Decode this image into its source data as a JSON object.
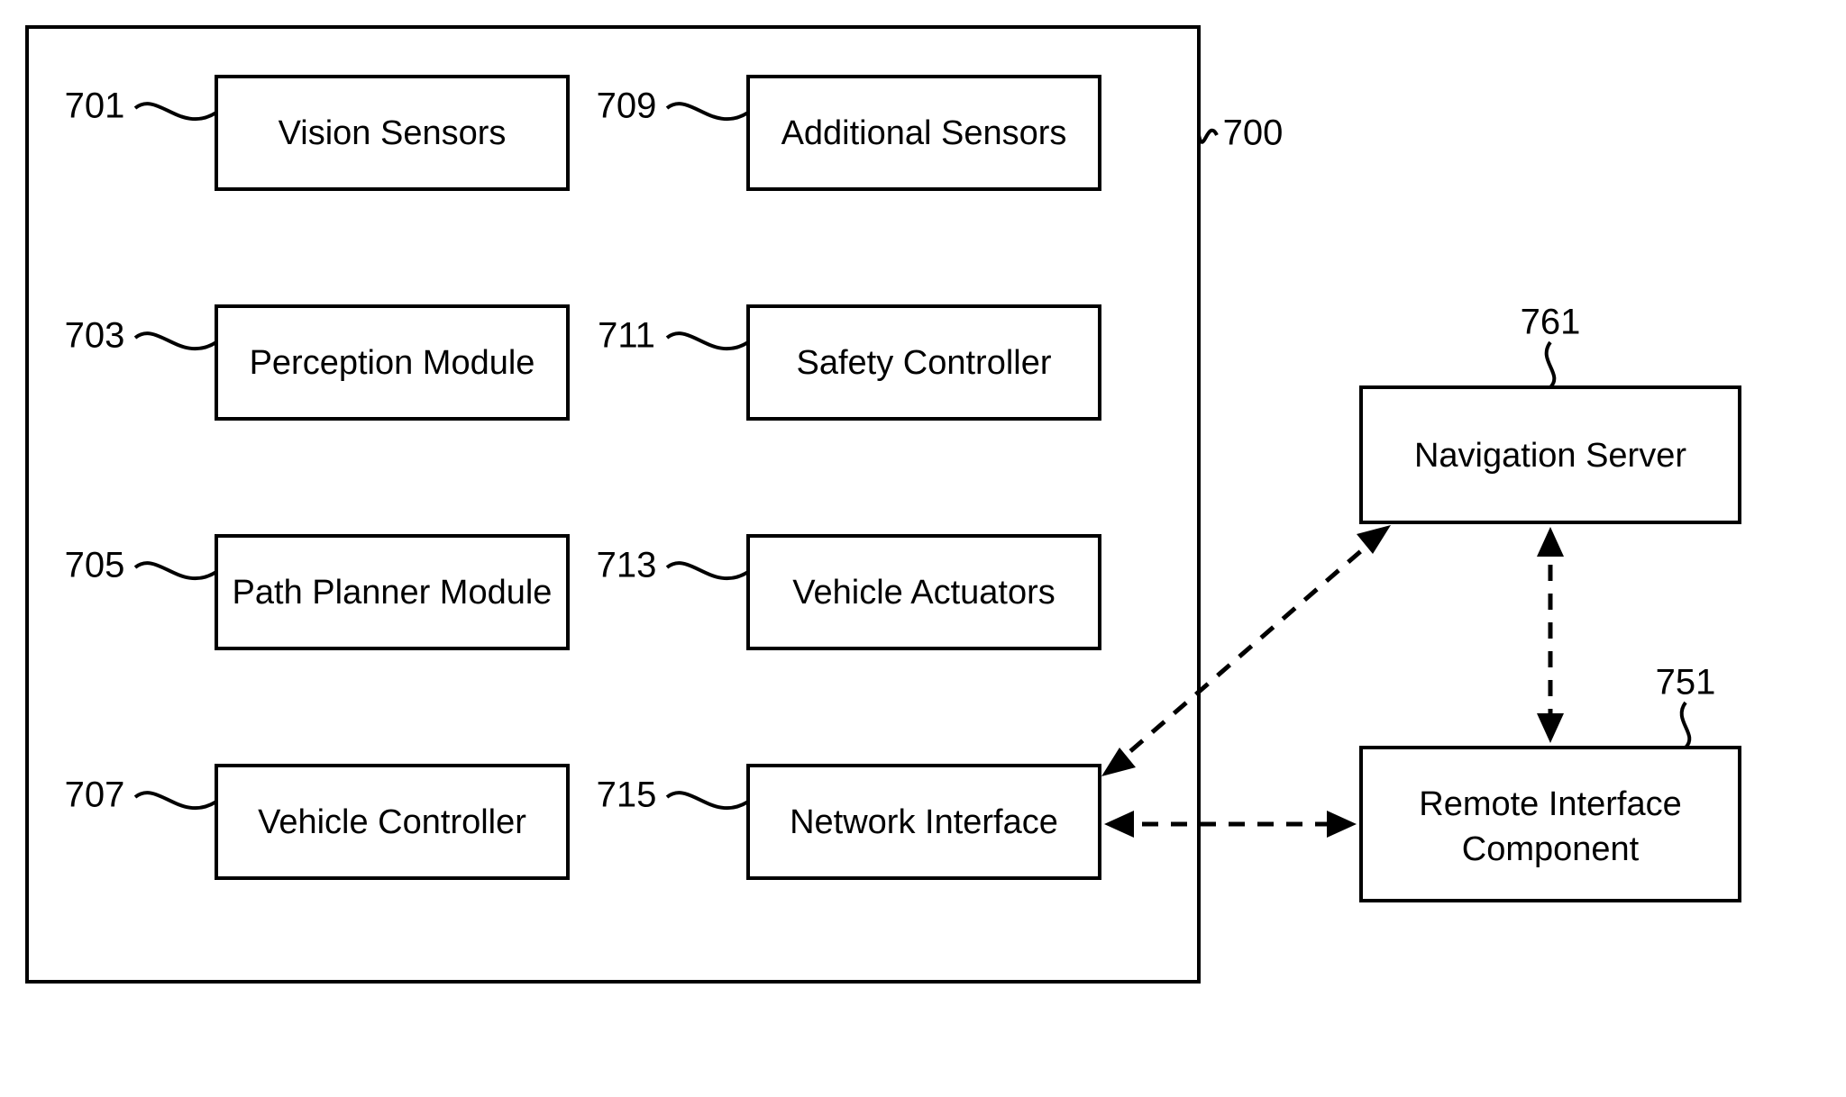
{
  "outer_ref": "700",
  "blocks": {
    "b701": {
      "ref": "701",
      "label": "Vision Sensors"
    },
    "b703": {
      "ref": "703",
      "label": "Perception Module"
    },
    "b705": {
      "ref": "705",
      "label": "Path Planner Module"
    },
    "b707": {
      "ref": "707",
      "label": "Vehicle Controller"
    },
    "b709": {
      "ref": "709",
      "label": "Additional Sensors"
    },
    "b711": {
      "ref": "711",
      "label": "Safety Controller"
    },
    "b713": {
      "ref": "713",
      "label": "Vehicle Actuators"
    },
    "b715": {
      "ref": "715",
      "label": "Network Interface"
    },
    "b761": {
      "ref": "761",
      "label": "Navigation Server"
    },
    "b751": {
      "ref": "751",
      "label_line1": "Remote Interface",
      "label_line2": "Component"
    }
  }
}
